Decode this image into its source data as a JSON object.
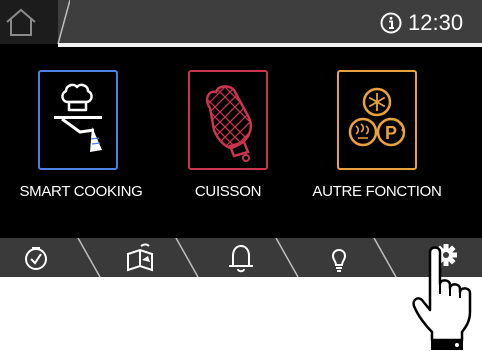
{
  "status_bar": {
    "home_icon": "home-icon",
    "info_icon": "info-icon",
    "time": "12:30"
  },
  "tiles": [
    {
      "label": "SMART COOKING",
      "icon": "chef-hat-serving-icon",
      "color": "#4f7fe0"
    },
    {
      "label": "CUISSON",
      "icon": "oven-mitt-icon",
      "color": "#c8354f"
    },
    {
      "label": "AUTRE FONCTION",
      "icon": "other-functions-icon",
      "color": "#e9a23a"
    }
  ],
  "bottom_nav": [
    {
      "icon": "timer-check-icon"
    },
    {
      "icon": "recipe-book-icon"
    },
    {
      "icon": "bell-icon"
    },
    {
      "icon": "lightbulb-icon"
    },
    {
      "icon": "gear-icon"
    }
  ],
  "overlay": {
    "icon": "pointing-hand-icon"
  }
}
